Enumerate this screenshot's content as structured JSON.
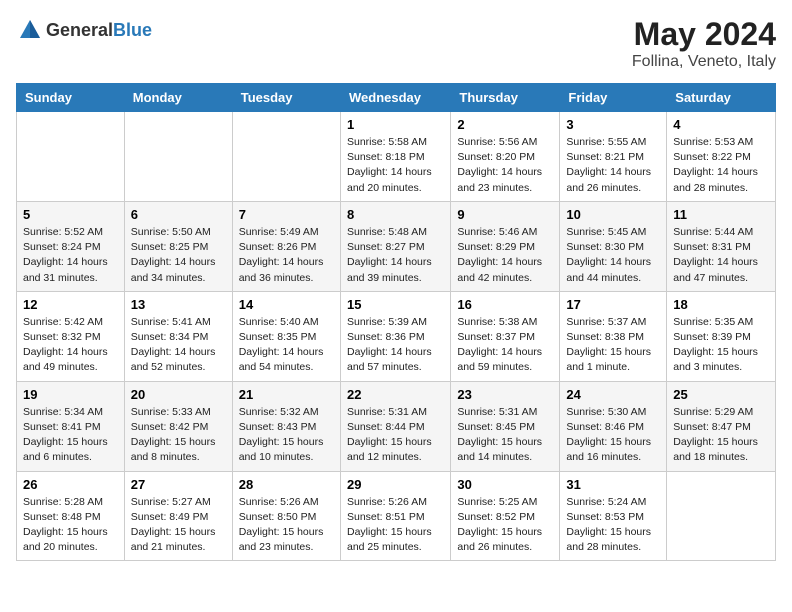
{
  "logo": {
    "general": "General",
    "blue": "Blue"
  },
  "title": {
    "month": "May 2024",
    "location": "Follina, Veneto, Italy"
  },
  "days_of_week": [
    "Sunday",
    "Monday",
    "Tuesday",
    "Wednesday",
    "Thursday",
    "Friday",
    "Saturday"
  ],
  "weeks": [
    [
      {
        "day": "",
        "info": ""
      },
      {
        "day": "",
        "info": ""
      },
      {
        "day": "",
        "info": ""
      },
      {
        "day": "1",
        "info": "Sunrise: 5:58 AM\nSunset: 8:18 PM\nDaylight: 14 hours\nand 20 minutes."
      },
      {
        "day": "2",
        "info": "Sunrise: 5:56 AM\nSunset: 8:20 PM\nDaylight: 14 hours\nand 23 minutes."
      },
      {
        "day": "3",
        "info": "Sunrise: 5:55 AM\nSunset: 8:21 PM\nDaylight: 14 hours\nand 26 minutes."
      },
      {
        "day": "4",
        "info": "Sunrise: 5:53 AM\nSunset: 8:22 PM\nDaylight: 14 hours\nand 28 minutes."
      }
    ],
    [
      {
        "day": "5",
        "info": "Sunrise: 5:52 AM\nSunset: 8:24 PM\nDaylight: 14 hours\nand 31 minutes."
      },
      {
        "day": "6",
        "info": "Sunrise: 5:50 AM\nSunset: 8:25 PM\nDaylight: 14 hours\nand 34 minutes."
      },
      {
        "day": "7",
        "info": "Sunrise: 5:49 AM\nSunset: 8:26 PM\nDaylight: 14 hours\nand 36 minutes."
      },
      {
        "day": "8",
        "info": "Sunrise: 5:48 AM\nSunset: 8:27 PM\nDaylight: 14 hours\nand 39 minutes."
      },
      {
        "day": "9",
        "info": "Sunrise: 5:46 AM\nSunset: 8:29 PM\nDaylight: 14 hours\nand 42 minutes."
      },
      {
        "day": "10",
        "info": "Sunrise: 5:45 AM\nSunset: 8:30 PM\nDaylight: 14 hours\nand 44 minutes."
      },
      {
        "day": "11",
        "info": "Sunrise: 5:44 AM\nSunset: 8:31 PM\nDaylight: 14 hours\nand 47 minutes."
      }
    ],
    [
      {
        "day": "12",
        "info": "Sunrise: 5:42 AM\nSunset: 8:32 PM\nDaylight: 14 hours\nand 49 minutes."
      },
      {
        "day": "13",
        "info": "Sunrise: 5:41 AM\nSunset: 8:34 PM\nDaylight: 14 hours\nand 52 minutes."
      },
      {
        "day": "14",
        "info": "Sunrise: 5:40 AM\nSunset: 8:35 PM\nDaylight: 14 hours\nand 54 minutes."
      },
      {
        "day": "15",
        "info": "Sunrise: 5:39 AM\nSunset: 8:36 PM\nDaylight: 14 hours\nand 57 minutes."
      },
      {
        "day": "16",
        "info": "Sunrise: 5:38 AM\nSunset: 8:37 PM\nDaylight: 14 hours\nand 59 minutes."
      },
      {
        "day": "17",
        "info": "Sunrise: 5:37 AM\nSunset: 8:38 PM\nDaylight: 15 hours\nand 1 minute."
      },
      {
        "day": "18",
        "info": "Sunrise: 5:35 AM\nSunset: 8:39 PM\nDaylight: 15 hours\nand 3 minutes."
      }
    ],
    [
      {
        "day": "19",
        "info": "Sunrise: 5:34 AM\nSunset: 8:41 PM\nDaylight: 15 hours\nand 6 minutes."
      },
      {
        "day": "20",
        "info": "Sunrise: 5:33 AM\nSunset: 8:42 PM\nDaylight: 15 hours\nand 8 minutes."
      },
      {
        "day": "21",
        "info": "Sunrise: 5:32 AM\nSunset: 8:43 PM\nDaylight: 15 hours\nand 10 minutes."
      },
      {
        "day": "22",
        "info": "Sunrise: 5:31 AM\nSunset: 8:44 PM\nDaylight: 15 hours\nand 12 minutes."
      },
      {
        "day": "23",
        "info": "Sunrise: 5:31 AM\nSunset: 8:45 PM\nDaylight: 15 hours\nand 14 minutes."
      },
      {
        "day": "24",
        "info": "Sunrise: 5:30 AM\nSunset: 8:46 PM\nDaylight: 15 hours\nand 16 minutes."
      },
      {
        "day": "25",
        "info": "Sunrise: 5:29 AM\nSunset: 8:47 PM\nDaylight: 15 hours\nand 18 minutes."
      }
    ],
    [
      {
        "day": "26",
        "info": "Sunrise: 5:28 AM\nSunset: 8:48 PM\nDaylight: 15 hours\nand 20 minutes."
      },
      {
        "day": "27",
        "info": "Sunrise: 5:27 AM\nSunset: 8:49 PM\nDaylight: 15 hours\nand 21 minutes."
      },
      {
        "day": "28",
        "info": "Sunrise: 5:26 AM\nSunset: 8:50 PM\nDaylight: 15 hours\nand 23 minutes."
      },
      {
        "day": "29",
        "info": "Sunrise: 5:26 AM\nSunset: 8:51 PM\nDaylight: 15 hours\nand 25 minutes."
      },
      {
        "day": "30",
        "info": "Sunrise: 5:25 AM\nSunset: 8:52 PM\nDaylight: 15 hours\nand 26 minutes."
      },
      {
        "day": "31",
        "info": "Sunrise: 5:24 AM\nSunset: 8:53 PM\nDaylight: 15 hours\nand 28 minutes."
      },
      {
        "day": "",
        "info": ""
      }
    ]
  ]
}
